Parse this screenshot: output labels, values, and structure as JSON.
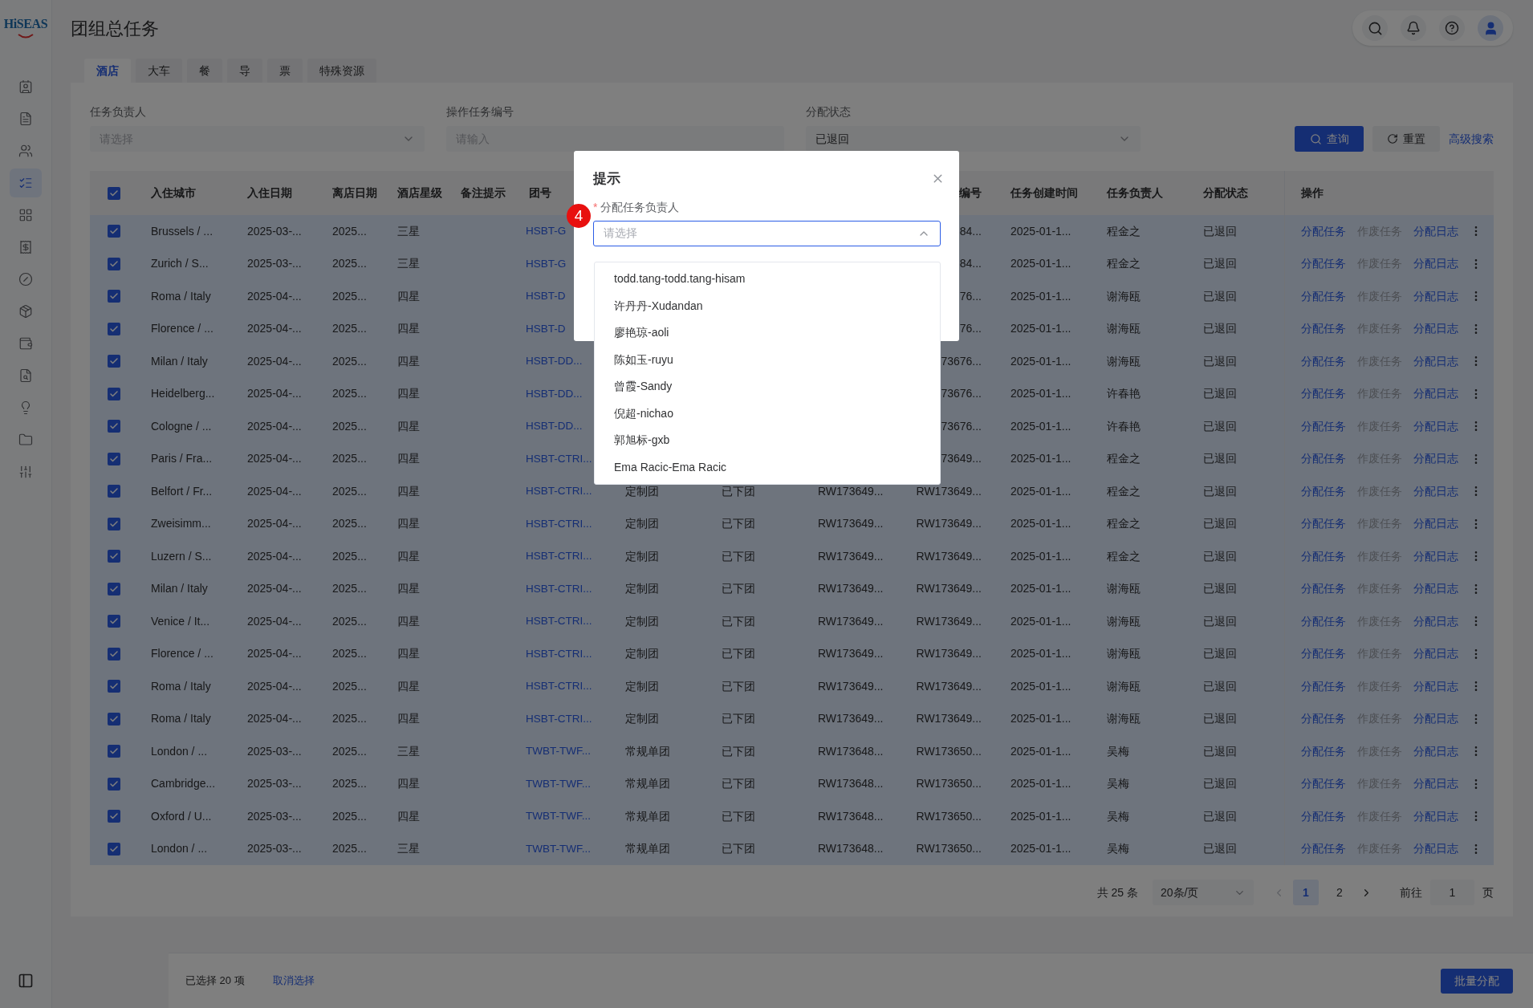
{
  "logo": "HiSEAS",
  "page_title": "团组总任务",
  "sidebar": {
    "items": [
      {
        "selected": false
      },
      {
        "selected": false
      },
      {
        "selected": false
      },
      {
        "selected": true
      },
      {
        "selected": false
      },
      {
        "selected": false
      },
      {
        "selected": false
      },
      {
        "selected": false
      },
      {
        "selected": false
      },
      {
        "selected": false
      },
      {
        "selected": false
      },
      {
        "selected": false
      },
      {
        "selected": false
      }
    ]
  },
  "tabs": [
    {
      "label": "酒店",
      "selected": true
    },
    {
      "label": "大车",
      "selected": false
    },
    {
      "label": "餐",
      "selected": false
    },
    {
      "label": "导",
      "selected": false
    },
    {
      "label": "票",
      "selected": false
    },
    {
      "label": "特殊资源",
      "selected": false
    }
  ],
  "filters": [
    {
      "label": "任务负责人",
      "kind": "select",
      "placeholder": "请选择"
    },
    {
      "label": "操作任务编号",
      "kind": "input",
      "placeholder": "请输入"
    },
    {
      "label": "分配状态",
      "kind": "select",
      "value": "已退回"
    }
  ],
  "buttons": {
    "search": "查询",
    "reset": "重置",
    "advanced": "高级搜索"
  },
  "table": {
    "all_checked": true,
    "columns": {
      "city": "入住城市",
      "check_in": "入住日期",
      "check_out": "离店日期",
      "hotel_star": "酒店星级",
      "remark": "备注提示",
      "group_no": "团号",
      "column_10": "编号",
      "created": "任务创建时间",
      "owner": "任务负责人",
      "status": "分配状态",
      "actions": "操作"
    },
    "rows": [
      {
        "checked": true,
        "city": "Brussels / ...",
        "check_in": "2025-03-...",
        "check_out": "2025...",
        "hotel_star": "三星",
        "group_no": "HSBT-G",
        "column_10": "84...",
        "created": "2025-01-1...",
        "owner": "程金之",
        "status": "已退回",
        "actions": [
          {
            "label": "分配任务",
            "disabled": false
          },
          {
            "label": "作废任务",
            "disabled": true
          },
          {
            "label": "分配日志",
            "disabled": false
          }
        ]
      },
      {
        "checked": true,
        "city": "Zurich / S...",
        "check_in": "2025-03-...",
        "check_out": "2025...",
        "hotel_star": "三星",
        "group_no": "HSBT-G",
        "column_10": "84...",
        "created": "2025-01-1...",
        "owner": "程金之",
        "status": "已退回",
        "actions": [
          {
            "label": "分配任务",
            "disabled": false
          },
          {
            "label": "作废任务",
            "disabled": true
          },
          {
            "label": "分配日志",
            "disabled": false
          }
        ]
      },
      {
        "checked": true,
        "city": "Roma / Italy",
        "check_in": "2025-04-...",
        "check_out": "2025...",
        "hotel_star": "四星",
        "group_no": "HSBT-D",
        "column_10": "76...",
        "created": "2025-01-1...",
        "owner": "谢海瓯",
        "status": "已退回",
        "actions": [
          {
            "label": "分配任务",
            "disabled": false
          },
          {
            "label": "作废任务",
            "disabled": true
          },
          {
            "label": "分配日志",
            "disabled": false
          }
        ]
      },
      {
        "checked": true,
        "city": "Florence / ...",
        "check_in": "2025-04-...",
        "check_out": "2025...",
        "hotel_star": "四星",
        "group_no": "HSBT-D",
        "column_10": "76...",
        "created": "2025-01-1...",
        "owner": "谢海瓯",
        "status": "已退回",
        "actions": [
          {
            "label": "分配任务",
            "disabled": false
          },
          {
            "label": "作废任务",
            "disabled": true
          },
          {
            "label": "分配日志",
            "disabled": false
          }
        ]
      },
      {
        "checked": true,
        "city": "Milan / Italy",
        "check_in": "2025-04-...",
        "check_out": "2025...",
        "hotel_star": "四星",
        "group_no": "HSBT-DD...",
        "column_10": "73676...",
        "created": "2025-01-1...",
        "owner": "谢海瓯",
        "status": "已退回",
        "actions": [
          {
            "label": "分配任务",
            "disabled": false
          },
          {
            "label": "作废任务",
            "disabled": true
          },
          {
            "label": "分配日志",
            "disabled": false
          }
        ]
      },
      {
        "checked": true,
        "city": "Heidelberg...",
        "check_in": "2025-04-...",
        "check_out": "2025...",
        "hotel_star": "四星",
        "group_no": "HSBT-DD...",
        "column_10": "73676...",
        "created": "2025-01-1...",
        "owner": "许春艳",
        "status": "已退回",
        "actions": [
          {
            "label": "分配任务",
            "disabled": false
          },
          {
            "label": "作废任务",
            "disabled": true
          },
          {
            "label": "分配日志",
            "disabled": false
          }
        ]
      },
      {
        "checked": true,
        "city": "Cologne / ...",
        "check_in": "2025-04-...",
        "check_out": "2025...",
        "hotel_star": "四星",
        "group_no": "HSBT-DD...",
        "column_10": "73676...",
        "created": "2025-01-1...",
        "owner": "许春艳",
        "status": "已退回",
        "actions": [
          {
            "label": "分配任务",
            "disabled": false
          },
          {
            "label": "作废任务",
            "disabled": true
          },
          {
            "label": "分配日志",
            "disabled": false
          }
        ]
      },
      {
        "checked": true,
        "city": "Paris / Fra...",
        "check_in": "2025-04-...",
        "check_out": "2025...",
        "hotel_star": "四星",
        "group_no": "HSBT-CTRI...",
        "column_10": "73649...",
        "created": "2025-01-1...",
        "owner": "程金之",
        "status": "已退回",
        "actions": [
          {
            "label": "分配任务",
            "disabled": false
          },
          {
            "label": "作废任务",
            "disabled": true
          },
          {
            "label": "分配日志",
            "disabled": false
          }
        ]
      },
      {
        "checked": true,
        "city": "Belfort / Fr...",
        "check_in": "2025-04-...",
        "check_out": "2025...",
        "hotel_star": "四星",
        "group_no": "HSBT-CTRI...",
        "column_7": "定制团",
        "column_8": "已下团",
        "column_9": "RW173649...",
        "column_10": "RW173649...",
        "created": "2025-01-1...",
        "owner": "程金之",
        "status": "已退回",
        "actions": [
          {
            "label": "分配任务",
            "disabled": false
          },
          {
            "label": "作废任务",
            "disabled": true
          },
          {
            "label": "分配日志",
            "disabled": false
          }
        ]
      },
      {
        "checked": true,
        "city": "Zweisimm...",
        "check_in": "2025-04-...",
        "check_out": "2025...",
        "hotel_star": "四星",
        "group_no": "HSBT-CTRI...",
        "column_7": "定制团",
        "column_8": "已下团",
        "column_9": "RW173649...",
        "column_10": "RW173649...",
        "created": "2025-01-1...",
        "owner": "程金之",
        "status": "已退回",
        "actions": [
          {
            "label": "分配任务",
            "disabled": false
          },
          {
            "label": "作废任务",
            "disabled": true
          },
          {
            "label": "分配日志",
            "disabled": false
          }
        ]
      },
      {
        "checked": true,
        "city": "Luzern / S...",
        "check_in": "2025-04-...",
        "check_out": "2025...",
        "hotel_star": "四星",
        "group_no": "HSBT-CTRI...",
        "column_7": "定制团",
        "column_8": "已下团",
        "column_9": "RW173649...",
        "column_10": "RW173649...",
        "created": "2025-01-1...",
        "owner": "程金之",
        "status": "已退回",
        "actions": [
          {
            "label": "分配任务",
            "disabled": false
          },
          {
            "label": "作废任务",
            "disabled": true
          },
          {
            "label": "分配日志",
            "disabled": false
          }
        ]
      },
      {
        "checked": true,
        "city": "Milan / Italy",
        "check_in": "2025-04-...",
        "check_out": "2025...",
        "hotel_star": "四星",
        "group_no": "HSBT-CTRI...",
        "column_7": "定制团",
        "column_8": "已下团",
        "column_9": "RW173649...",
        "column_10": "RW173649...",
        "created": "2025-01-1...",
        "owner": "谢海瓯",
        "status": "已退回",
        "actions": [
          {
            "label": "分配任务",
            "disabled": false
          },
          {
            "label": "作废任务",
            "disabled": true
          },
          {
            "label": "分配日志",
            "disabled": false
          }
        ]
      },
      {
        "checked": true,
        "city": "Venice / It...",
        "check_in": "2025-04-...",
        "check_out": "2025...",
        "hotel_star": "四星",
        "group_no": "HSBT-CTRI...",
        "column_7": "定制团",
        "column_8": "已下团",
        "column_9": "RW173649...",
        "column_10": "RW173649...",
        "created": "2025-01-1...",
        "owner": "谢海瓯",
        "status": "已退回",
        "actions": [
          {
            "label": "分配任务",
            "disabled": false
          },
          {
            "label": "作废任务",
            "disabled": true
          },
          {
            "label": "分配日志",
            "disabled": false
          }
        ]
      },
      {
        "checked": true,
        "city": "Florence / ...",
        "check_in": "2025-04-...",
        "check_out": "2025...",
        "hotel_star": "四星",
        "group_no": "HSBT-CTRI...",
        "column_7": "定制团",
        "column_8": "已下团",
        "column_9": "RW173649...",
        "column_10": "RW173649...",
        "created": "2025-01-1...",
        "owner": "谢海瓯",
        "status": "已退回",
        "actions": [
          {
            "label": "分配任务",
            "disabled": false
          },
          {
            "label": "作废任务",
            "disabled": true
          },
          {
            "label": "分配日志",
            "disabled": false
          }
        ]
      },
      {
        "checked": true,
        "city": "Roma / Italy",
        "check_in": "2025-04-...",
        "check_out": "2025...",
        "hotel_star": "四星",
        "group_no": "HSBT-CTRI...",
        "column_7": "定制团",
        "column_8": "已下团",
        "column_9": "RW173649...",
        "column_10": "RW173649...",
        "created": "2025-01-1...",
        "owner": "谢海瓯",
        "status": "已退回",
        "actions": [
          {
            "label": "分配任务",
            "disabled": false
          },
          {
            "label": "作废任务",
            "disabled": true
          },
          {
            "label": "分配日志",
            "disabled": false
          }
        ]
      },
      {
        "checked": true,
        "city": "Roma / Italy",
        "check_in": "2025-04-...",
        "check_out": "2025...",
        "hotel_star": "四星",
        "group_no": "HSBT-CTRI...",
        "column_7": "定制团",
        "column_8": "已下团",
        "column_9": "RW173649...",
        "column_10": "RW173649...",
        "created": "2025-01-1...",
        "owner": "谢海瓯",
        "status": "已退回",
        "actions": [
          {
            "label": "分配任务",
            "disabled": false
          },
          {
            "label": "作废任务",
            "disabled": true
          },
          {
            "label": "分配日志",
            "disabled": false
          }
        ]
      },
      {
        "checked": true,
        "city": "London / ...",
        "check_in": "2025-03-...",
        "check_out": "2025...",
        "hotel_star": "三星",
        "group_no": "TWBT-TWF...",
        "column_7": "常规单团",
        "column_8": "已下团",
        "column_9": "RW173648...",
        "column_10": "RW173650...",
        "created": "2025-01-1...",
        "owner": "吴梅",
        "status": "已退回",
        "actions": [
          {
            "label": "分配任务",
            "disabled": false
          },
          {
            "label": "作废任务",
            "disabled": true
          },
          {
            "label": "分配日志",
            "disabled": false
          }
        ]
      },
      {
        "checked": true,
        "city": "Cambridge...",
        "check_in": "2025-03-...",
        "check_out": "2025...",
        "hotel_star": "四星",
        "group_no": "TWBT-TWF...",
        "column_7": "常规单团",
        "column_8": "已下团",
        "column_9": "RW173648...",
        "column_10": "RW173650...",
        "created": "2025-01-1...",
        "owner": "吴梅",
        "status": "已退回",
        "actions": [
          {
            "label": "分配任务",
            "disabled": false
          },
          {
            "label": "作废任务",
            "disabled": true
          },
          {
            "label": "分配日志",
            "disabled": false
          }
        ]
      },
      {
        "checked": true,
        "city": "Oxford / U...",
        "check_in": "2025-03-...",
        "check_out": "2025...",
        "hotel_star": "四星",
        "group_no": "TWBT-TWF...",
        "column_7": "常规单团",
        "column_8": "已下团",
        "column_9": "RW173648...",
        "column_10": "RW173650...",
        "created": "2025-01-1...",
        "owner": "吴梅",
        "status": "已退回",
        "actions": [
          {
            "label": "分配任务",
            "disabled": false
          },
          {
            "label": "作废任务",
            "disabled": true
          },
          {
            "label": "分配日志",
            "disabled": false
          }
        ]
      },
      {
        "checked": true,
        "city": "London / ...",
        "check_in": "2025-03-...",
        "check_out": "2025...",
        "hotel_star": "三星",
        "group_no": "TWBT-TWF...",
        "column_7": "常规单团",
        "column_8": "已下团",
        "column_9": "RW173648...",
        "column_10": "RW173650...",
        "created": "2025-01-1...",
        "owner": "吴梅",
        "status": "已退回",
        "actions": [
          {
            "label": "分配任务",
            "disabled": false
          },
          {
            "label": "作废任务",
            "disabled": true
          },
          {
            "label": "分配日志",
            "disabled": false
          }
        ]
      }
    ]
  },
  "pagination": {
    "total": "共 25 条",
    "page_size": "20条/页",
    "pages": [
      {
        "label": "1",
        "selected": true
      },
      {
        "label": "2",
        "selected": false
      }
    ],
    "goto_label": "前往",
    "goto_value": "1",
    "goto_suffix": "页"
  },
  "footer": {
    "selected_count": "已选择 20 项",
    "clear": "取消选择",
    "batch": "批量分配"
  },
  "dialog": {
    "title": "提示",
    "step_badge": "4",
    "field_label": "分配任务负责人",
    "required_mark": "*",
    "placeholder": "请选择",
    "expanded": true,
    "options": [
      {
        "label": "todd.tang-todd.tang-hisam",
        "selected": false
      },
      {
        "label": "许丹丹-Xudandan",
        "selected": false
      },
      {
        "label": "廖艳琼-aoli",
        "selected": false
      },
      {
        "label": "陈如玉-ruyu",
        "selected": false
      },
      {
        "label": "曾霞-Sandy",
        "selected": false
      },
      {
        "label": "倪超-nichao",
        "selected": false
      },
      {
        "label": "郭旭标-gxb",
        "selected": false
      },
      {
        "label": "Ema Racic-Ema Racic",
        "selected": false
      }
    ]
  }
}
